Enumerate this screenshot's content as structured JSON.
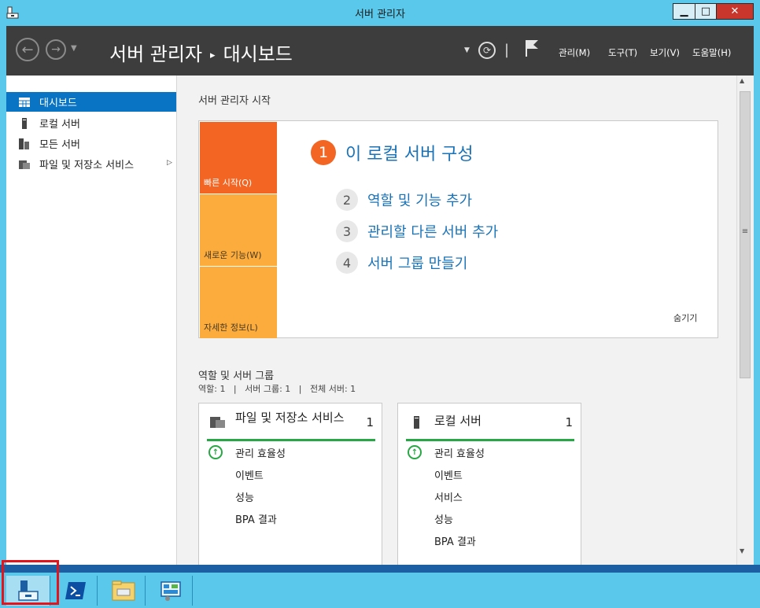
{
  "window": {
    "title": "서버 관리자"
  },
  "header": {
    "breadcrumb_root": "서버 관리자",
    "breadcrumb_arrow": "▸",
    "breadcrumb_page": "대시보드",
    "separator": "|",
    "menus": {
      "manage": "관리(M)",
      "tools": "도구(T)",
      "view": "보기(V)",
      "help": "도움말(H)"
    }
  },
  "sidebar": {
    "items": [
      {
        "label": "대시보드",
        "icon": "dashboard-icon",
        "selected": true
      },
      {
        "label": "로컬 서버",
        "icon": "server-icon"
      },
      {
        "label": "모든 서버",
        "icon": "servers-icon"
      },
      {
        "label": "파일 및 저장소 서비스",
        "icon": "file-storage-icon"
      }
    ]
  },
  "quick_start": {
    "section_title": "서버 관리자 시작",
    "tiles": {
      "quick": "빠른 시작(Q)",
      "new": "새로운 기능(W)",
      "info": "자세한 정보(L)"
    },
    "steps": [
      {
        "num": "1",
        "label": "이 로컬 서버 구성"
      },
      {
        "num": "2",
        "label": "역할 및 기능 추가"
      },
      {
        "num": "3",
        "label": "관리할 다른 서버 추가"
      },
      {
        "num": "4",
        "label": "서버 그룹 만들기"
      }
    ],
    "hide": "숨기기"
  },
  "roles": {
    "title": "역할 및 서버 그룹",
    "summary": "역할: 1   |   서버 그룹: 1   |   전체 서버: 1",
    "cards": [
      {
        "title": "파일 및 저장소 서비스",
        "count": "1",
        "rows": [
          "관리 효율성",
          "이벤트",
          "성능",
          "BPA 결과"
        ]
      },
      {
        "title": "로컬 서버",
        "count": "1",
        "rows": [
          "관리 효율성",
          "이벤트",
          "서비스",
          "성능",
          "BPA 결과"
        ]
      }
    ]
  },
  "colors": {
    "accent": "#0a74c4",
    "orange": "#f36522",
    "amber": "#fbac3d",
    "status_ok": "#28a745",
    "header_bg": "#3d3d3d"
  }
}
